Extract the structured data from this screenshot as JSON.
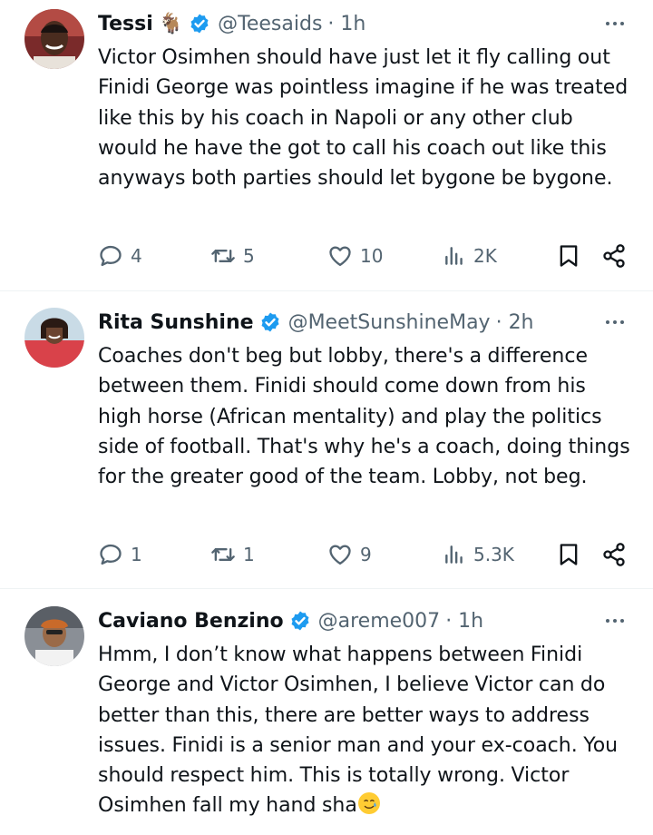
{
  "tweets": [
    {
      "name": "Tessi",
      "name_emoji": "🐐",
      "handle": "@Teesaids",
      "time": "· 1h",
      "text": "Victor Osimhen should have just let it fly calling out Finidi George was pointless imagine if he was treated like this by his coach in Napoli or any other club would he have the got to call his coach out like this anyways both parties should let bygone be bygone.",
      "replies": "4",
      "reposts": "5",
      "likes": "10",
      "views": "2K"
    },
    {
      "name": "Rita Sunshine",
      "handle": "@MeetSunshineMay",
      "time": "· 2h",
      "text": "Coaches don't beg but lobby, there's a difference between them. Finidi should come down from his high horse (African mentality) and play the politics side of football. That's why he's a coach, doing things for the greater good of the team. Lobby, not beg.",
      "replies": "1",
      "reposts": "1",
      "likes": "9",
      "views": "5.3K"
    },
    {
      "name": "Caviano Benzino",
      "handle": "@areme007",
      "time": "· 1h",
      "text": "Hmm, I don’t know what happens between Finidi George and Victor Osimhen, I believe Victor can do better than this, there are better ways to address issues. Finidi is a senior man and your ex-coach. You should respect him. This is totally wrong. Victor Osimhen fall my hand sha",
      "text_emoji": "🥲"
    }
  ],
  "colors": {
    "verified": "#1d9bf0",
    "secondary_text": "#536471",
    "primary_text": "#0f1419",
    "divider": "#eff3f4"
  },
  "icons": [
    "reply-icon",
    "repost-icon",
    "like-icon",
    "views-icon",
    "bookmark-icon",
    "share-icon",
    "more-icon",
    "verified-icon"
  ]
}
